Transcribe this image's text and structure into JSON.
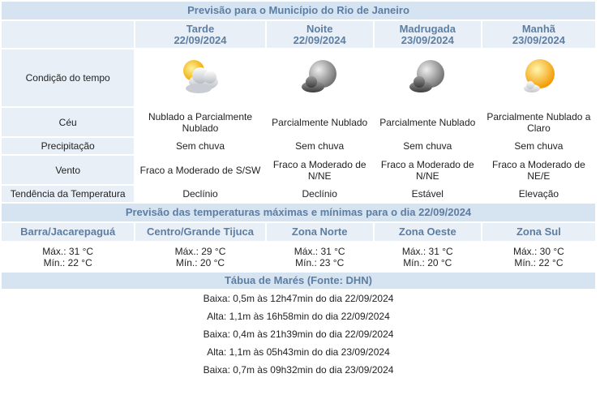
{
  "main_title": "Previsão para o Município do Rio de Janeiro",
  "periods": [
    {
      "name": "Tarde",
      "date": "22/09/2024",
      "icon": "partly-cloudy-icon",
      "ceu": "Nublado a Parcialmente Nublado",
      "precip": "Sem chuva",
      "vento": "Fraco a Moderado de S/SW",
      "tendencia": "Declínio"
    },
    {
      "name": "Noite",
      "date": "22/09/2024",
      "icon": "moon-cloudy-icon",
      "ceu": "Parcialmente Nublado",
      "precip": "Sem chuva",
      "vento": "Fraco a Moderado de N/NE",
      "tendencia": "Declínio"
    },
    {
      "name": "Madrugada",
      "date": "23/09/2024",
      "icon": "moon-cloudy-icon",
      "ceu": "Parcialmente Nublado",
      "precip": "Sem chuva",
      "vento": "Fraco a Moderado de N/NE",
      "tendencia": "Estável"
    },
    {
      "name": "Manhã",
      "date": "23/09/2024",
      "icon": "sun-cloud-icon",
      "ceu": "Parcialmente Nublado a Claro",
      "precip": "Sem chuva",
      "vento": "Fraco a Moderado de NE/E",
      "tendencia": "Elevação"
    }
  ],
  "row_labels": {
    "condicao": "Condição do tempo",
    "ceu": "Céu",
    "precip": "Precipitação",
    "vento": "Vento",
    "tendencia": "Tendência da Temperatura"
  },
  "temps_title": "Previsão das temperaturas máximas e mínimas para o dia 22/09/2024",
  "zones": [
    {
      "name": "Barra/Jacarepaguá",
      "max": "Máx.: 31 °C",
      "min": "Mín.: 22 °C"
    },
    {
      "name": "Centro/Grande Tijuca",
      "max": "Máx.: 29 °C",
      "min": "Mín.: 20 °C"
    },
    {
      "name": "Zona Norte",
      "max": "Máx.: 31 °C",
      "min": "Mín.: 23 °C"
    },
    {
      "name": "Zona Oeste",
      "max": "Máx.: 31 °C",
      "min": "Mín.: 20 °C"
    },
    {
      "name": "Zona Sul",
      "max": "Máx.: 30 °C",
      "min": "Mín.: 22 °C"
    }
  ],
  "tides_title": "Tábua de Marés (Fonte: DHN)",
  "tides": [
    "Baixa: 0,5m às 12h47min do dia 22/09/2024",
    "Alta: 1,1m às 16h58min do dia 22/09/2024",
    "Baixa: 0,4m às 21h39min do dia 22/09/2024",
    "Alta: 1,1m às 05h43min do dia 23/09/2024",
    "Baixa: 0,7m às 09h32min do dia 23/09/2024"
  ],
  "colors": {
    "header_bg": "#d6e3f0",
    "cell_bg": "#e8eff7",
    "accent_text": "#5d7ea3"
  }
}
